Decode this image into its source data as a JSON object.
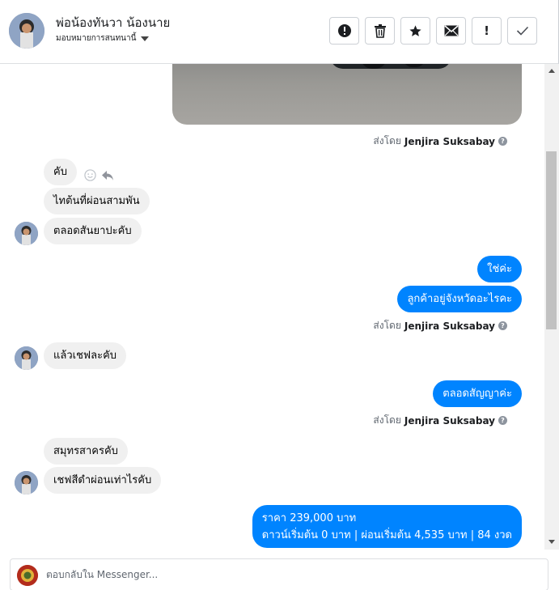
{
  "header": {
    "contact_name": "พ่อน้องทันวา น้องนาย",
    "assign_label": "มอบหมายการสนทนานี้",
    "actions": [
      {
        "icon": "alert-circle-icon"
      },
      {
        "icon": "trash-icon"
      },
      {
        "icon": "star-icon"
      },
      {
        "icon": "envelope-icon"
      },
      {
        "icon": "exclamation-icon",
        "text": "!"
      },
      {
        "icon": "check-icon"
      }
    ]
  },
  "thread": {
    "sent_by_prefix": "ส่งโดย",
    "sent_by_name": "Jenjira Suksabay",
    "messages": [
      {
        "from": "contact",
        "text": "คับ"
      },
      {
        "from": "contact",
        "text": "ไทต้นที่ผ่อนสามพัน"
      },
      {
        "from": "contact",
        "text": "ตลอดสันยาปะคับ"
      },
      {
        "from": "page",
        "text": "ใช่ค่ะ"
      },
      {
        "from": "page",
        "text": "ลูกค้าอยู่จังหวัดอะไรคะ"
      },
      {
        "from": "contact",
        "text": "แล้วเชฟละคับ"
      },
      {
        "from": "page",
        "text": "ตลอดสัญญาค่ะ"
      },
      {
        "from": "contact",
        "text": "สมุทรสาครคับ"
      },
      {
        "from": "contact",
        "text": "เชฟสีดำผ่อนเท่าไรคับ"
      },
      {
        "from": "page",
        "text_line1": "ราคา 239,000 บาท",
        "text_line2": "ดาวน์เริ่มต้น 0 บาท | ผ่อนเริ่มต้น 4,535 บาท | 84 งวด"
      }
    ]
  },
  "reply": {
    "placeholder": "ตอบกลับใน Messenger..."
  },
  "colors": {
    "outgoing": "#0084ff",
    "incoming": "#f0f0f0",
    "border": "#ccd0d5"
  }
}
